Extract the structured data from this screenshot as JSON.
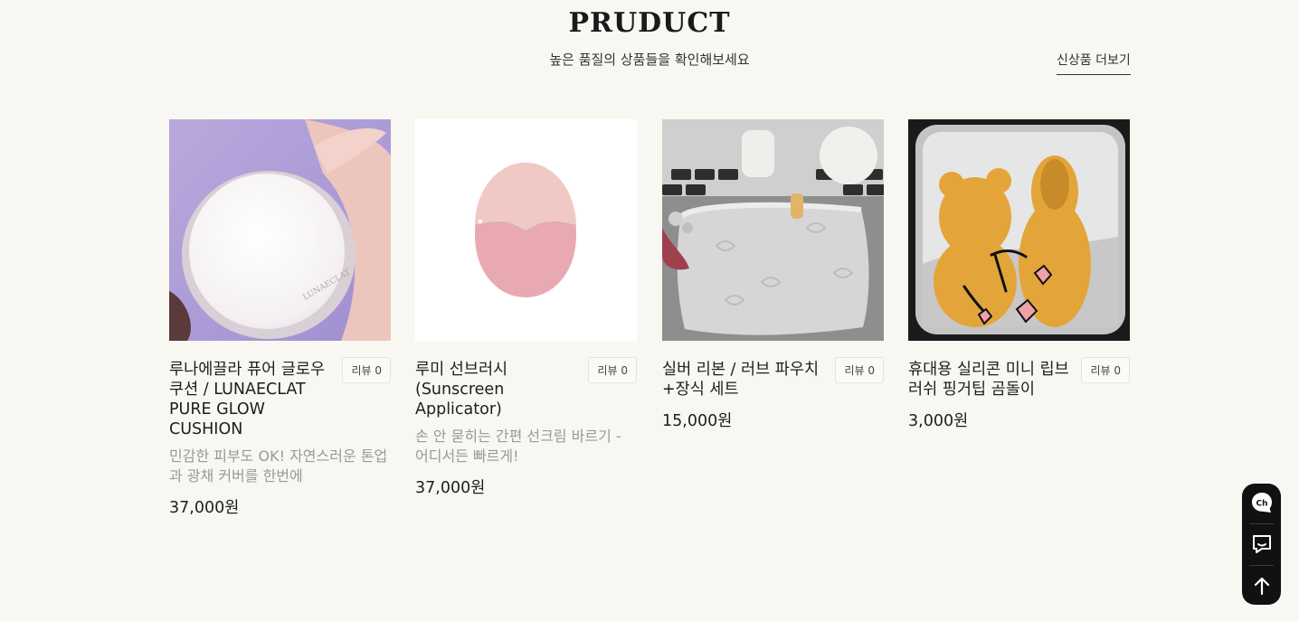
{
  "section": {
    "title": "PRUDUCT",
    "subtitle": "높은 품질의 상품들을 확인해보세요",
    "more_link": "신상품 더보기"
  },
  "products": [
    {
      "name": "루나에끌라 퓨어 글로우 쿠션 / LUNAECLAT PURE GLOW CUSHION",
      "review": "리뷰 0",
      "desc": "민감한 피부도 OK! 자연스러운 톤업과 광채 커버를 한번에",
      "price": "37,000원",
      "image_text": "LUNAECLAT"
    },
    {
      "name": "루미 선브러시 (Sunscreen Applicator)",
      "review": "리뷰 0",
      "desc": "손 안 묻히는 간편 선크림 바르기 - 어디서든 빠르게!",
      "price": "37,000원"
    },
    {
      "name": "실버 리본 / 러브 파우치 +장식 세트",
      "review": "리뷰 0",
      "desc": "",
      "price": "15,000원"
    },
    {
      "name": "휴대용 실리콘 미니 립브러쉬 핑거팁 곰돌이",
      "review": "리뷰 0",
      "desc": "",
      "price": "3,000원"
    }
  ],
  "floating": {
    "buttons": [
      "chat-icon",
      "message-icon",
      "arrow-up-icon"
    ]
  }
}
